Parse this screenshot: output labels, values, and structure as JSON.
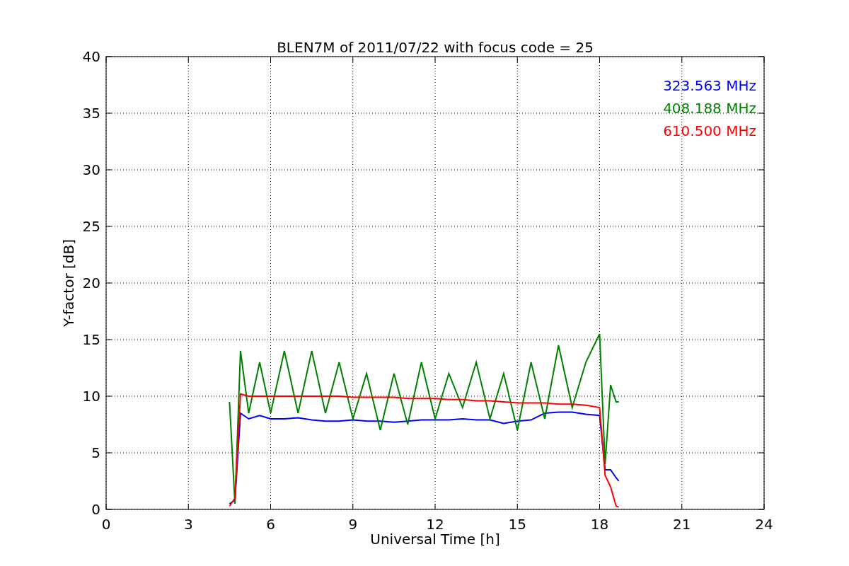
{
  "chart_data": {
    "type": "line",
    "title": "BLEN7M of 2011/07/22 with focus code = 25",
    "xlabel": "Universal Time [h]",
    "ylabel": "Y-factor [dB]",
    "x": [
      4.5,
      4.7,
      4.9,
      5.2,
      5.6,
      6,
      6.5,
      7,
      7.5,
      8,
      8.5,
      9,
      9.5,
      10,
      10.5,
      11,
      11.5,
      12,
      12.5,
      13,
      13.5,
      14,
      14.5,
      15,
      15.5,
      16,
      16.5,
      17,
      17.5,
      18,
      18.2,
      18.4,
      18.6,
      18.7
    ],
    "series": [
      {
        "name": "323.563 MHz",
        "color": "#0000ff",
        "values": [
          0.5,
          0.8,
          8.5,
          8,
          8.3,
          8,
          8,
          8.1,
          7.9,
          7.8,
          7.8,
          7.9,
          7.8,
          7.8,
          7.7,
          7.8,
          7.9,
          7.9,
          7.9,
          8,
          7.9,
          7.9,
          7.6,
          7.8,
          7.9,
          8.5,
          8.6,
          8.6,
          8.4,
          8.3,
          3.5,
          3.5,
          2.8,
          2.5
        ]
      },
      {
        "name": "408.188 MHz",
        "color": "#008000",
        "values": [
          9.5,
          0.5,
          14,
          8.5,
          13,
          8.5,
          14,
          8.5,
          14,
          8.5,
          13,
          8,
          12,
          7,
          12,
          7.5,
          13,
          8,
          12,
          9,
          13,
          8,
          12,
          7,
          13,
          8,
          14.5,
          9,
          13,
          15.5,
          4,
          11,
          9.5,
          9.5
        ]
      },
      {
        "name": "610.500 MHz",
        "color": "#ff0000",
        "values": [
          0.3,
          1,
          10.2,
          10,
          10,
          10,
          10,
          10,
          10,
          10,
          10,
          9.9,
          9.9,
          9.9,
          9.9,
          9.8,
          9.8,
          9.8,
          9.7,
          9.7,
          9.6,
          9.6,
          9.5,
          9.4,
          9.4,
          9.4,
          9.3,
          9.3,
          9.2,
          9,
          3,
          2,
          0.3,
          0.2
        ]
      }
    ],
    "grid": true,
    "xlim": [
      0,
      24
    ],
    "ylim": [
      0,
      40
    ],
    "xticks": [
      0,
      3,
      6,
      9,
      12,
      15,
      18,
      21,
      24
    ],
    "yticks": [
      0,
      5,
      10,
      15,
      20,
      25,
      30,
      35,
      40
    ]
  }
}
